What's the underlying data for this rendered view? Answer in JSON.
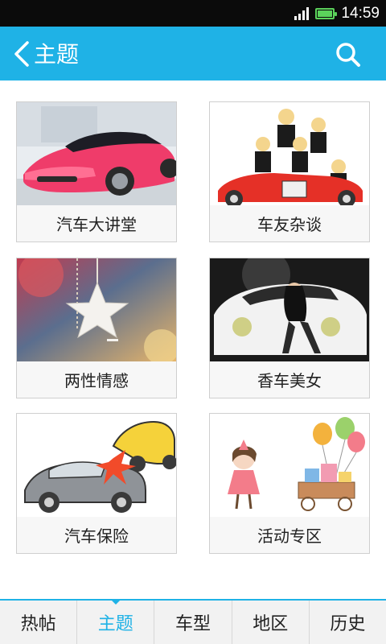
{
  "status_bar": {
    "time": "14:59"
  },
  "header": {
    "title": "主题"
  },
  "cards": [
    {
      "label": "汽车大讲堂"
    },
    {
      "label": "车友杂谈"
    },
    {
      "label": "两性情感"
    },
    {
      "label": "香车美女"
    },
    {
      "label": "汽车保险"
    },
    {
      "label": "活动专区"
    }
  ],
  "tabs": [
    {
      "label": "热帖"
    },
    {
      "label": "主题"
    },
    {
      "label": "车型"
    },
    {
      "label": "地区"
    },
    {
      "label": "历史"
    }
  ],
  "colors": {
    "accent": "#1fb2e6",
    "status_bg": "#0b0b0b",
    "battery": "#5bd25b"
  },
  "icons": [
    "back-arrow-icon",
    "search-icon",
    "signal-icon",
    "battery-icon"
  ]
}
